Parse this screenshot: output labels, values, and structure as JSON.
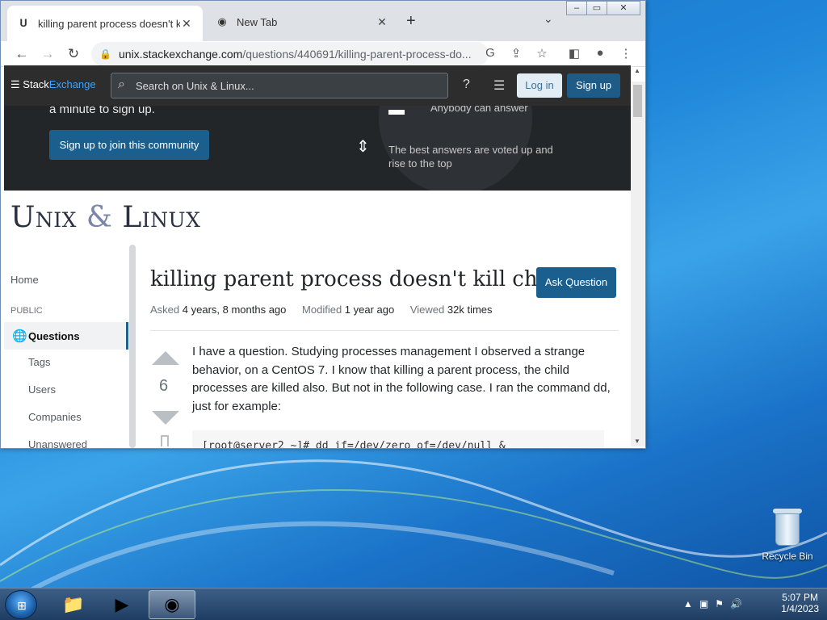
{
  "browser": {
    "tabs": [
      {
        "title": "killing parent process doesn't kill",
        "favicon": "unix-linux-favicon"
      },
      {
        "title": "New Tab",
        "favicon": "chrome-icon"
      }
    ],
    "url_domain": "unix.stackexchange.com",
    "url_path": "/questions/440691/killing-parent-process-do..."
  },
  "header": {
    "logo_text_1": "Stack",
    "logo_text_2": "Exchange",
    "search_placeholder": "Search on Unix & Linux...",
    "login_label": "Log in",
    "signup_label": "Sign up"
  },
  "banner": {
    "signup_text": "a minute to sign up.",
    "join_label": "Sign up to join this community",
    "item_anybody": "Anybody can answer",
    "item_best_1": "The best answers are voted up and",
    "item_best_2": "rise to the top"
  },
  "site": {
    "title_1": "Unix",
    "title_amp": "&",
    "title_2": "Linux"
  },
  "sidebar": {
    "home": "Home",
    "public": "PUBLIC",
    "questions": "Questions",
    "tags": "Tags",
    "users": "Users",
    "companies": "Companies",
    "unanswered": "Unanswered"
  },
  "question": {
    "title": "killing parent process doesn't kill child",
    "ask_label": "Ask Question",
    "asked_label": "Asked",
    "asked_value": "4 years, 8 months ago",
    "modified_label": "Modified",
    "modified_value": "1 year ago",
    "viewed_label": "Viewed",
    "viewed_value": "32k times",
    "votes": "6",
    "body": "I have a question. Studying processes management I observed a strange behavior, on a CentOS 7. I know that killing a parent process, the child processes are killed also. But not in the following case. I ran the command dd, just for example:",
    "code": "[root@server2 ~]# dd if=/dev/zero of=/dev/null &"
  },
  "desktop": {
    "recycle_bin": "Recycle Bin",
    "time": "5:07 PM",
    "date": "1/4/2023"
  }
}
